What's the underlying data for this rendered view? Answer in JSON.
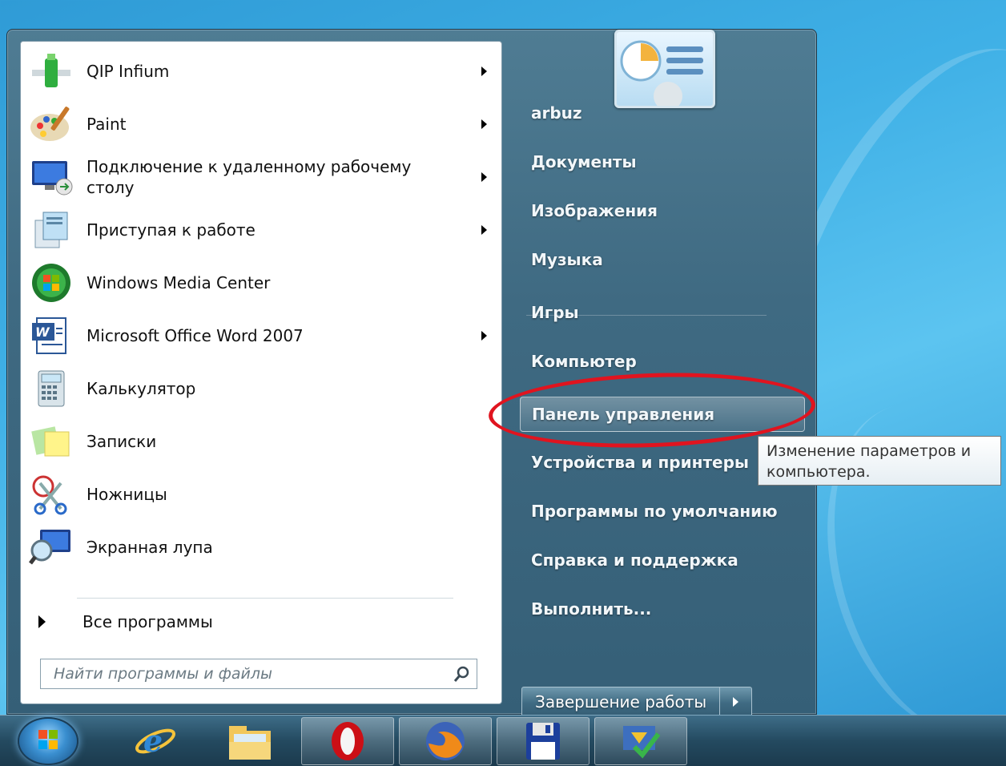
{
  "programs": [
    {
      "label": "QIP Infium",
      "has_arrow": true,
      "icon": "qip-icon"
    },
    {
      "label": "Paint",
      "has_arrow": true,
      "icon": "paint-palette-icon"
    },
    {
      "label": "Подключение к удаленному рабочему столу",
      "has_arrow": true,
      "icon": "remote-desktop-icon"
    },
    {
      "label": "Приступая к работе",
      "has_arrow": true,
      "icon": "getting-started-icon"
    },
    {
      "label": "Windows Media Center",
      "has_arrow": false,
      "icon": "media-center-icon"
    },
    {
      "label": "Microsoft Office Word 2007",
      "has_arrow": true,
      "icon": "word-icon"
    },
    {
      "label": "Калькулятор",
      "has_arrow": false,
      "icon": "calculator-icon"
    },
    {
      "label": "Записки",
      "has_arrow": false,
      "icon": "sticky-notes-icon"
    },
    {
      "label": "Ножницы",
      "has_arrow": false,
      "icon": "scissors-icon"
    },
    {
      "label": "Экранная лупа",
      "has_arrow": false,
      "icon": "magnifier-icon"
    }
  ],
  "all_programs": "Все программы",
  "search": {
    "placeholder": "Найти программы и файлы"
  },
  "right_pane": {
    "items": [
      "arbuz",
      "Документы",
      "Изображения",
      "Музыка",
      "Игры",
      "Компьютер",
      "Панель управления",
      "Устройства и принтеры",
      "Программы по умолчанию",
      "Справка и поддержка",
      "Выполнить..."
    ],
    "highlighted": "Панель управления"
  },
  "shutdown_label": "Завершение работы",
  "tooltip": "Изменение параметров и компьютера.",
  "taskbar": {
    "items": [
      "start-orb",
      "internet-explorer-icon",
      "file-explorer-icon",
      "opera-icon",
      "firefox-icon",
      "floppy-save-icon",
      "checkmark-app-icon"
    ]
  },
  "colors": {
    "annotation": "#e0141f",
    "menu_dark": "#3f6a82"
  }
}
